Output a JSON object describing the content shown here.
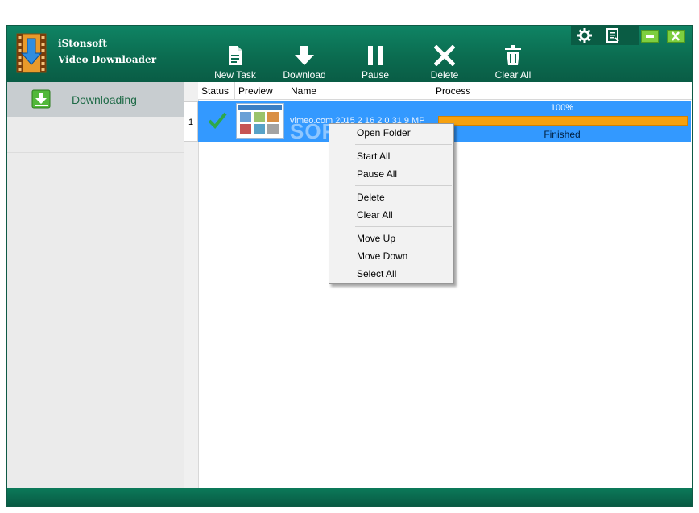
{
  "app": {
    "title_line1": "iStonsoft",
    "title_line2": "Video Downloader"
  },
  "toolbar": {
    "new_task": "New Task",
    "download": "Download",
    "pause": "Pause",
    "delete": "Delete",
    "clear_all": "Clear All"
  },
  "sidebar": {
    "items": [
      {
        "label": "Downloading",
        "icon": "download-arrow-icon"
      }
    ]
  },
  "table": {
    "columns": [
      "Status",
      "Preview",
      "Name",
      "Process"
    ],
    "rows": [
      {
        "num": "1",
        "status": "check-icon",
        "name": "vimeo.com 2015 2 16 2 0 31 9 MP",
        "percent": "100%",
        "progress": 1.0,
        "state": "Finished"
      }
    ]
  },
  "watermark": "SOFTPEDIA",
  "context_menu": {
    "items": [
      "Open Folder",
      "Start All",
      "Pause All",
      "Delete",
      "Clear All",
      "Move Up",
      "Move Down",
      "Select All"
    ]
  },
  "colors": {
    "header": "#0b6c50",
    "selection": "#3399ff",
    "progress": "#f7a10e"
  }
}
